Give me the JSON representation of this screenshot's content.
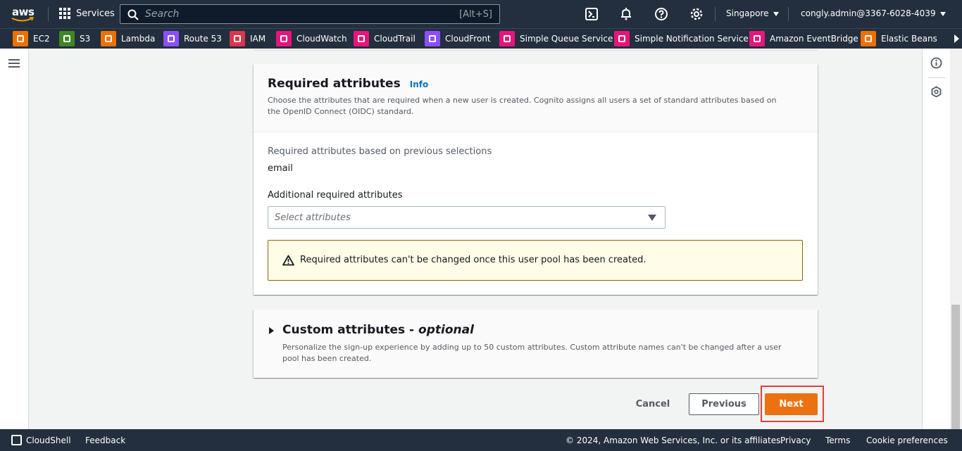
{
  "topnav": {
    "logo_text": "aws",
    "services_label": "Services",
    "search_placeholder": "Search",
    "search_shortcut": "[Alt+S]",
    "region": "Singapore",
    "account": "congly.admin@3367-6028-4039",
    "icons": [
      "cloudshell-icon",
      "notifications-icon",
      "help-icon",
      "settings-icon"
    ]
  },
  "favorites": [
    {
      "label": "EC2",
      "color": "#ed7100"
    },
    {
      "label": "S3",
      "color": "#3f8624"
    },
    {
      "label": "Lambda",
      "color": "#ed7100"
    },
    {
      "label": "Route 53",
      "color": "#8c4fff"
    },
    {
      "label": "IAM",
      "color": "#dd344c"
    },
    {
      "label": "CloudWatch",
      "color": "#e7157b"
    },
    {
      "label": "CloudTrail",
      "color": "#e7157b"
    },
    {
      "label": "CloudFront",
      "color": "#8c4fff"
    },
    {
      "label": "Simple Queue Service",
      "color": "#e7157b"
    },
    {
      "label": "Simple Notification Service",
      "color": "#e7157b"
    },
    {
      "label": "Amazon EventBridge",
      "color": "#e7157b"
    },
    {
      "label": "Elastic Beans",
      "color": "#ed7100"
    }
  ],
  "required_attributes": {
    "title": "Required attributes",
    "info_link": "Info",
    "description": "Choose the attributes that are required when a new user is created. Cognito assigns all users a set of standard attributes based on the OpenID Connect (OIDC) standard.",
    "based_on_label": "Required attributes based on previous selections",
    "based_on_value": "email",
    "additional_label": "Additional required attributes",
    "select_placeholder": "Select attributes",
    "warning": "Required attributes can't be changed once this user pool has been created."
  },
  "custom_attributes": {
    "title": "Custom attributes - ",
    "title_suffix": "optional",
    "description": "Personalize the sign-up experience by adding up to 50 custom attributes. Custom attribute names can't be changed after a user pool has been created."
  },
  "actions": {
    "cancel": "Cancel",
    "previous": "Previous",
    "next": "Next"
  },
  "footer": {
    "cloudshell": "CloudShell",
    "feedback": "Feedback",
    "copyright": "© 2024, Amazon Web Services, Inc. or its affiliates.",
    "privacy": "Privacy",
    "terms": "Terms",
    "cookie": "Cookie preferences"
  },
  "colors": {
    "nav_bg": "#232f3e",
    "primary_button": "#ec7211",
    "link": "#0073bb",
    "highlight": "#e0413a"
  }
}
